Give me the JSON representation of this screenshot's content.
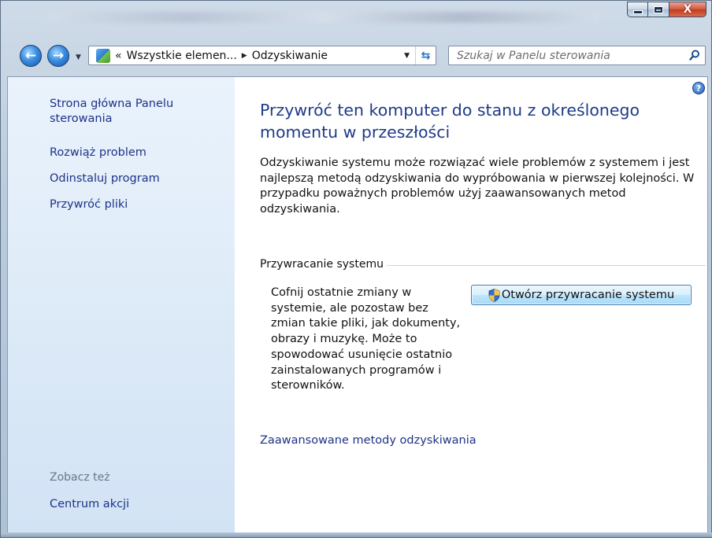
{
  "window": {
    "caption_buttons": {
      "minimize": "minimize",
      "maximize": "maximize",
      "close": "X"
    }
  },
  "navigation": {
    "back_icon": "back-arrow",
    "forward_icon": "forward-arrow",
    "address": {
      "separator": "«",
      "breadcrumbs": [
        "Wszystkie elemen...",
        "Odzyskiwanie"
      ],
      "crumb_arrow": "▶"
    },
    "search": {
      "placeholder": "Szukaj w Panelu sterowania"
    }
  },
  "sidebar": {
    "home_link": "Strona główna Panelu sterowania",
    "links": [
      "Rozwiąż problem",
      "Odinstaluj program",
      "Przywróć pliki"
    ],
    "see_also_label": "Zobacz też",
    "see_also_links": [
      "Centrum akcji"
    ]
  },
  "main": {
    "title": "Przywróć ten komputer do stanu z określonego momentu w przeszłości",
    "description": "Odzyskiwanie systemu może rozwiązać wiele problemów z systemem i jest najlepszą metodą odzyskiwania do wypróbowania w pierwszej kolejności. W przypadku poważnych problemów użyj zaawansowanych metod odzyskiwania.",
    "group_title": "Przywracanie systemu",
    "group_description": "Cofnij ostatnie zmiany w systemie, ale pozostaw bez zmian takie pliki, jak dokumenty, obrazy i muzykę. Może to spowodować usunięcie ostatnio zainstalowanych programów i sterowników.",
    "action_button": "Otwórz przywracanie systemu",
    "advanced_link": "Zaawansowane metody odzyskiwania"
  },
  "colors": {
    "link": "#1e3287",
    "title": "#1e3b8a",
    "sidebar_bg": "#dbe9f7"
  }
}
